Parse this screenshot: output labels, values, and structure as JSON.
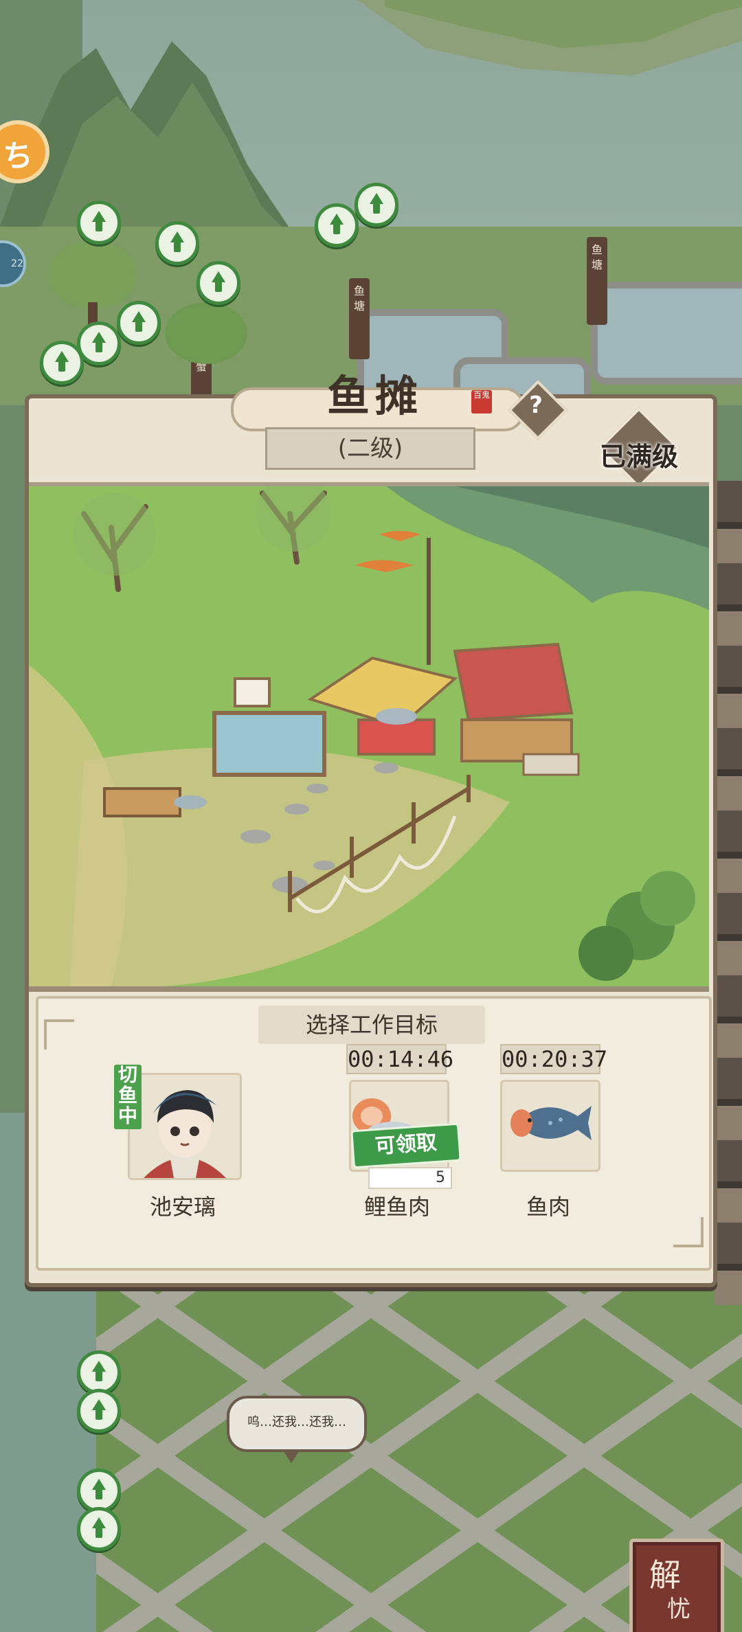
{
  "world": {
    "signposts": [
      "鱼\n塘",
      "鱼\n塘",
      "鱼\n塘",
      "蟹"
    ],
    "speech_bubble": "呜…还我…还我…",
    "side_orange_icon": "ち",
    "side_blue_value": "22",
    "bottom_button": {
      "line1": "解",
      "line2": "忧"
    }
  },
  "dialog": {
    "title": "鱼摊",
    "title_stamp": "百鬼",
    "help_label": "?",
    "level": "(二级)",
    "max_level_label": "已满级",
    "target_header": "选择工作目标",
    "worker": {
      "name": "池安璃",
      "status": "切鱼中"
    },
    "targets": [
      {
        "name": "鲤鱼肉",
        "timer": "00:14:46",
        "claim_label": "可领取",
        "count": "5"
      },
      {
        "name": "鱼肉",
        "timer": "00:20:37"
      }
    ]
  },
  "colors": {
    "accent_green": "#3d9a48",
    "frame_brown": "#7b6a58",
    "panel_cream": "#ece4d2",
    "stamp_red": "#c83a30"
  }
}
